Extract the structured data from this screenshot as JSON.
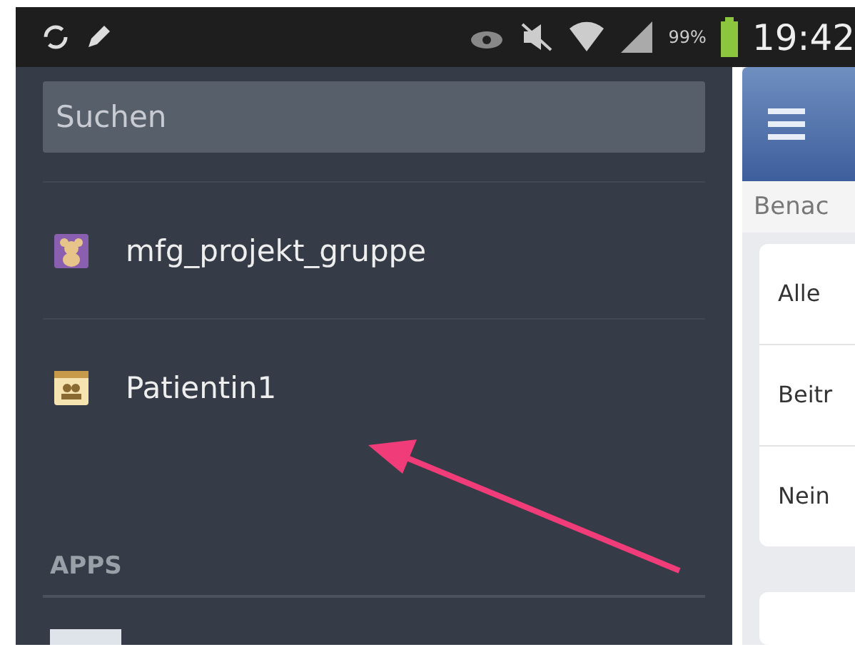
{
  "status_bar": {
    "battery": "99%",
    "time": "19:42"
  },
  "drawer": {
    "search": {
      "placeholder": "Suchen"
    },
    "items": [
      {
        "label": "mfg_projekt_gruppe",
        "kind": "group"
      },
      {
        "label": "Patientin1",
        "kind": "event"
      }
    ],
    "section": "APPS"
  },
  "main": {
    "section_title": "Benac",
    "options": [
      "Alle",
      "Beitr",
      "Nein"
    ]
  }
}
